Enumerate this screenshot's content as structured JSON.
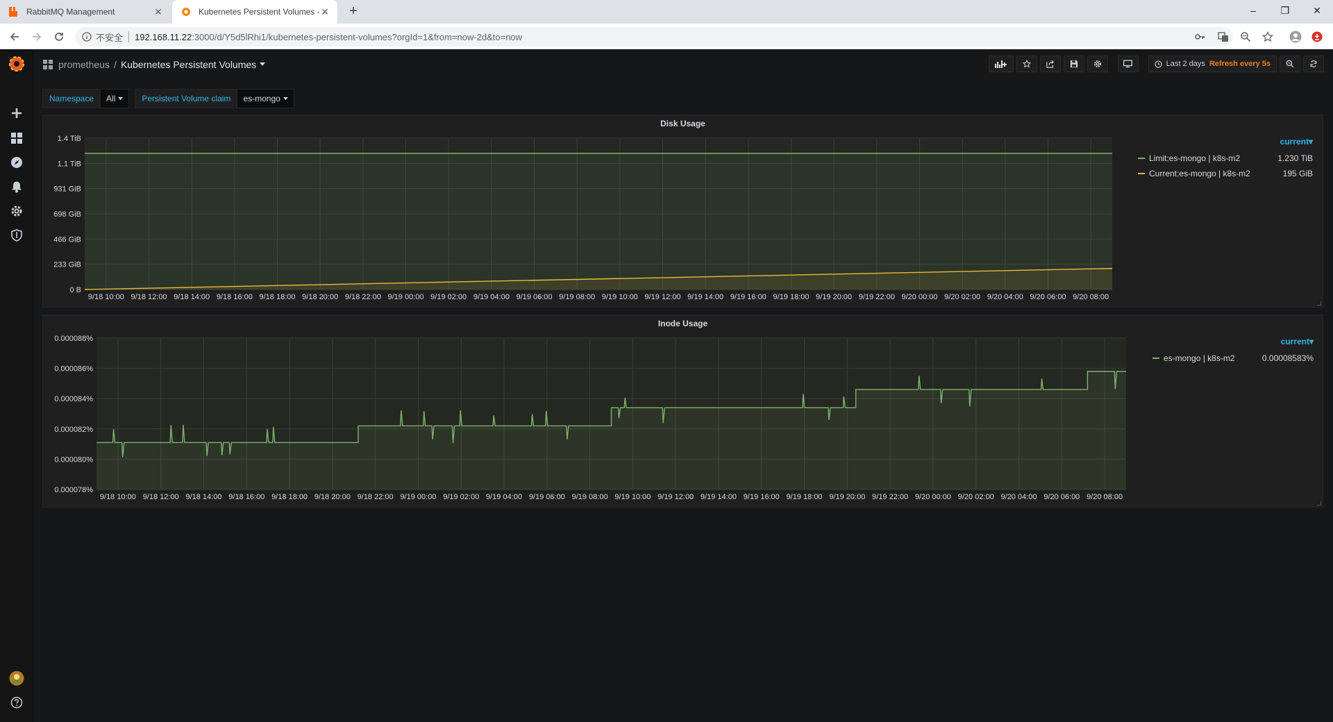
{
  "browser": {
    "tabs": [
      {
        "title": "RabbitMQ Management"
      },
      {
        "title": "Kubernetes Persistent Volumes -"
      }
    ],
    "url": {
      "insecure_label": "不安全",
      "host": "192.168.11.22",
      "path": ":3000/d/Y5d5lRhi1/kubernetes-persistent-volumes?orgId=1&from=now-2d&to=now"
    }
  },
  "grafana": {
    "breadcrumb": {
      "folder": "prometheus",
      "separator": "/",
      "title": "Kubernetes Persistent Volumes"
    },
    "time_picker": {
      "range": "Last 2 days",
      "refresh": "Refresh every 5s"
    },
    "variables": [
      {
        "label": "Namespace",
        "value": "All"
      },
      {
        "label": "Persistent Volume claim",
        "value": "es-mongo"
      }
    ],
    "icons": [
      "grafana-logo-icon",
      "plus-icon",
      "dashboards-icon",
      "explore-icon",
      "alerting-icon",
      "configuration-icon",
      "server-admin-icon",
      "user-avatar-icon",
      "help-icon"
    ],
    "colors": {
      "green": "#7eb26d",
      "yellow": "#eab839",
      "link": "#33b5e5",
      "refresh": "#eb7b18"
    }
  },
  "chart_data": [
    {
      "type": "line",
      "title": "Disk Usage",
      "x_ticks": [
        "9/18 10:00",
        "9/18 12:00",
        "9/18 14:00",
        "9/18 16:00",
        "9/18 18:00",
        "9/18 20:00",
        "9/18 22:00",
        "9/19 00:00",
        "9/19 02:00",
        "9/19 04:00",
        "9/19 06:00",
        "9/19 08:00",
        "9/19 10:00",
        "9/19 12:00",
        "9/19 14:00",
        "9/19 16:00",
        "9/19 18:00",
        "9/19 20:00",
        "9/19 22:00",
        "9/20 00:00",
        "9/20 02:00",
        "9/20 04:00",
        "9/20 06:00",
        "9/20 08:00"
      ],
      "y_ticks": [
        "1.4 TiB",
        "1.1 TiB",
        "931 GiB",
        "698 GiB",
        "466 GiB",
        "233 GiB",
        "0 B"
      ],
      "ylim_gib": [
        0,
        1400
      ],
      "legend_header": "current",
      "series": [
        {
          "name": "Limit:es-mongo | k8s-m2",
          "current": "1.230 TiB",
          "color": "#7eb26d",
          "values_gib": [
            1259.5,
            1259.5
          ]
        },
        {
          "name": "Current:es-mongo | k8s-m2",
          "current": "195 GiB",
          "color": "#eab839",
          "values_gib": [
            0,
            195
          ]
        }
      ]
    },
    {
      "type": "line",
      "title": "Inode Usage",
      "x_ticks": [
        "9/18 10:00",
        "9/18 12:00",
        "9/18 14:00",
        "9/18 16:00",
        "9/18 18:00",
        "9/18 20:00",
        "9/18 22:00",
        "9/19 00:00",
        "9/19 02:00",
        "9/19 04:00",
        "9/19 06:00",
        "9/19 08:00",
        "9/19 10:00",
        "9/19 12:00",
        "9/19 14:00",
        "9/19 16:00",
        "9/19 18:00",
        "9/19 20:00",
        "9/19 22:00",
        "9/20 00:00",
        "9/20 02:00",
        "9/20 04:00",
        "9/20 06:00",
        "9/20 08:00"
      ],
      "y_ticks": [
        "0.000088%",
        "0.000086%",
        "0.000084%",
        "0.000082%",
        "0.000080%",
        "0.000078%"
      ],
      "ylim_percent": [
        7.8e-05,
        8.8e-05
      ],
      "legend_header": "current",
      "series": [
        {
          "name": "es-mongo | k8s-m2",
          "current": "0.00008583%",
          "color": "#7eb26d",
          "steps": [
            {
              "from_tick": 0,
              "value": 8.11e-05
            },
            {
              "from_tick": 5.6,
              "value": 8.22e-05
            },
            {
              "from_tick": 11.5,
              "value": 8.34e-05
            },
            {
              "from_tick": 17.2,
              "value": 8.46e-05
            },
            {
              "from_tick": 22.6,
              "value": 8.58e-05
            }
          ]
        }
      ]
    }
  ]
}
